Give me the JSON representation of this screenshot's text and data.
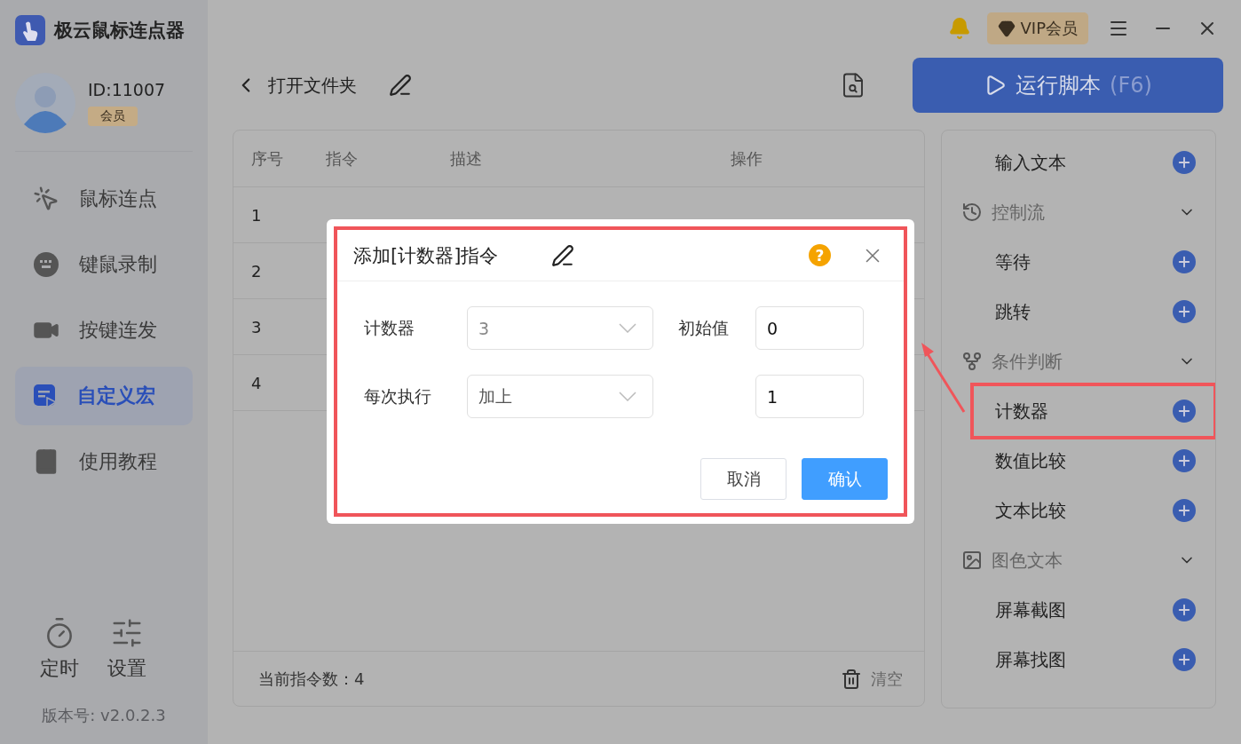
{
  "app": {
    "title": "极云鼠标连点器"
  },
  "user": {
    "id": "ID:11007",
    "badge": "会员"
  },
  "nav": [
    {
      "label": "鼠标连点",
      "selected": false
    },
    {
      "label": "键鼠录制",
      "selected": false
    },
    {
      "label": "按键连发",
      "selected": false
    },
    {
      "label": "自定义宏",
      "selected": true
    },
    {
      "label": "使用教程",
      "selected": false
    }
  ],
  "bottom_nav": [
    {
      "label": "定时"
    },
    {
      "label": "设置"
    }
  ],
  "version": "版本号: v2.0.2.3",
  "topbar": {
    "vip": "VIP会员"
  },
  "header": {
    "title": "打开文件夹"
  },
  "run_button": {
    "label": "运行脚本",
    "shortcut": "(F6)"
  },
  "table": {
    "columns": [
      "序号",
      "指令",
      "描述",
      "操作"
    ],
    "rows": [
      {
        "index": "1"
      },
      {
        "index": "2"
      },
      {
        "index": "3"
      },
      {
        "index": "4"
      }
    ]
  },
  "footer": {
    "count": "当前指令数：4",
    "clear": "清空"
  },
  "palette": [
    {
      "kind": "item",
      "label": "输入文本",
      "highlighted": false
    },
    {
      "kind": "group",
      "label": "控制流",
      "expanded": true
    },
    {
      "kind": "item",
      "label": "等待",
      "highlighted": false
    },
    {
      "kind": "item",
      "label": "跳转",
      "highlighted": false
    },
    {
      "kind": "group",
      "label": "条件判断",
      "expanded": true
    },
    {
      "kind": "item",
      "label": "计数器",
      "highlighted": true
    },
    {
      "kind": "item",
      "label": "数值比较",
      "highlighted": false
    },
    {
      "kind": "item",
      "label": "文本比较",
      "highlighted": false
    },
    {
      "kind": "group",
      "label": "图色文本",
      "expanded": true
    },
    {
      "kind": "item",
      "label": "屏幕截图",
      "highlighted": false
    },
    {
      "kind": "item",
      "label": "屏幕找图",
      "highlighted": false
    }
  ],
  "dialog": {
    "title": "添加[计数器]指令",
    "help": "?",
    "highlighted": true,
    "rows": [
      {
        "label": "计数器",
        "select": "3",
        "value_label": "初始值",
        "value": "0"
      },
      {
        "label": "每次执行",
        "select": "加上",
        "value": "1"
      }
    ],
    "buttons": [
      {
        "label": "取消",
        "kind": "secondary"
      },
      {
        "label": "确认",
        "kind": "primary"
      }
    ]
  }
}
